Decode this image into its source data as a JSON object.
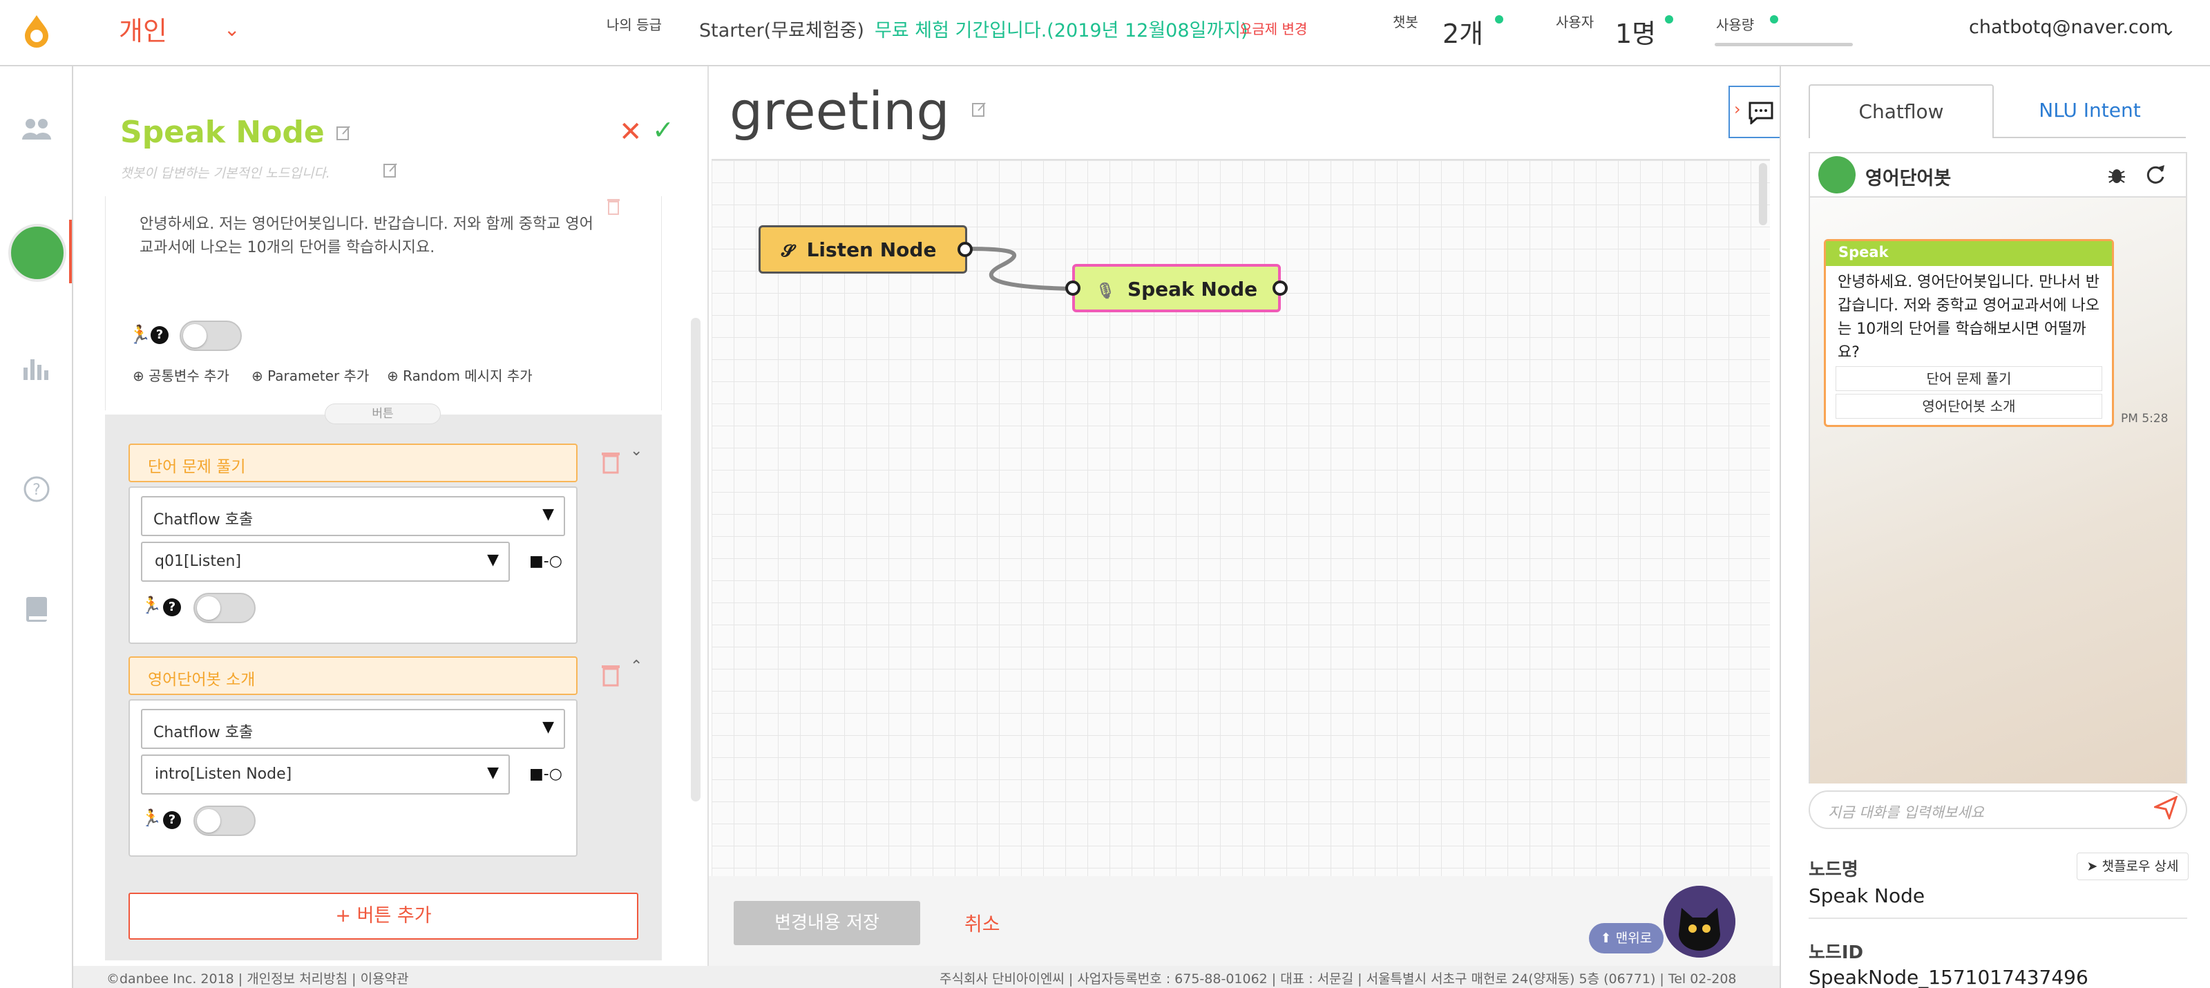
{
  "topbar": {
    "workspace": "개인",
    "my_grade_label": "나의 등급",
    "plan": "Starter(무료체험중)",
    "trial_notice": "무료 체험 기간입니다.(2019년 12월08일까지)",
    "change_plan": "요금제 변경",
    "chatbots_label": "챗봇",
    "chatbots_value": "2개",
    "users_label": "사용자",
    "users_value": "1명",
    "usage_label": "사용량",
    "account": "chatbotq@naver.com"
  },
  "editor": {
    "title": "Speak Node",
    "subtitle": "챗봇이 답변하는 기본적인 노드입니다.",
    "speak_text": "안녕하세요. 저는 영어단어봇입니다. 반갑습니다. 저와 함께 중학교 영어교과서에 나오는 10개의 단어를 학습하시지요.",
    "add_common_var": "공통변수 추가",
    "add_parameter": "Parameter 추가",
    "add_random_msg": "Random 메시지 추가",
    "section_label": "버튼",
    "buttons": [
      {
        "label": "단어 문제 풀기",
        "action": "Chatflow 호출",
        "target": "q01[Listen]"
      },
      {
        "label": "영어단어봇 소개",
        "action": "Chatflow 호출",
        "target": "intro[Listen Node]"
      }
    ],
    "add_button": "+ 버튼 추가"
  },
  "canvas": {
    "title": "greeting",
    "nodes": {
      "listen": "Listen Node",
      "speak": "Speak Node"
    },
    "save": "변경내용 저장",
    "cancel": "취소",
    "to_top": "⬆ 맨위로"
  },
  "right": {
    "tabs": [
      "Chatflow",
      "NLU Intent"
    ],
    "bot_name": "영어단어봇",
    "bubble_header": "Speak",
    "bubble_text": "안녕하세요. 영어단어봇입니다. 만나서 반갑습니다. 저와 중학교 영어교과서에 나오는 10개의 단어를 학습해보시면 어떨까요?",
    "quick_replies": [
      "단어 문제 풀기",
      "영어단어봇 소개"
    ],
    "time": "PM 5:28",
    "input_placeholder": "지금 대화를 입력해보세요",
    "node_name_label": "노드명",
    "node_name_value": "Speak Node",
    "detail_button": "챗플로우 상세",
    "node_id_label": "노드ID",
    "node_id_value": "SpeakNode_1571017437496"
  },
  "footer": {
    "left": "©danbee Inc. 2018 | 개인정보 처리방침 | 이용약관",
    "right": "주식회사 단비아이엔씨 | 사업자등록번호 : 675-88-01062 | 대표 : 서문길 | 서울특별시 서초구 매헌로 24(양재동) 5층 (06771) | Tel 02-208"
  },
  "colors": {
    "accent": "#f0593e",
    "green": "#1ec08f",
    "node_green": "#a8d63f",
    "link_blue": "#2b7cd3"
  }
}
